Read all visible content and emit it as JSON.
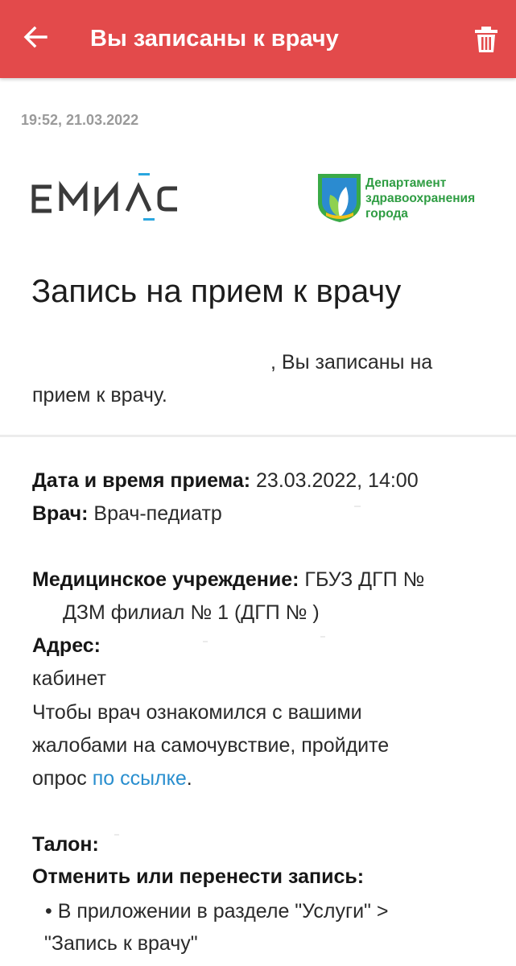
{
  "header": {
    "title": "Вы записаны к врачу",
    "back_icon": "arrow-left-icon",
    "delete_icon": "trash-icon",
    "background": "#e34a4b"
  },
  "timestamp": "19:52, 21.03.2022",
  "logos": {
    "emias": "ЕМИАС",
    "dzm_lines": [
      "Департамент",
      "здравоохранения",
      "города"
    ]
  },
  "heading": "Запись на прием к врачу",
  "greeting": {
    "line1": ", Вы записаны на",
    "line2": "прием к врачу."
  },
  "details": {
    "datetime_label": "Дата и время приема:",
    "datetime_value": " 23.03.2022, 14:00",
    "doctor_label": "Врач:",
    "doctor_value": " Врач-педиатр",
    "clinic_label": "Медицинское учреждение:",
    "clinic_value": " ГБУЗ ДГП №",
    "clinic_value2": "ДЗМ филиал № 1 (ДГП №       )",
    "address_label": "Адрес:",
    "cabinet": "кабинет",
    "survey_line1": "Чтобы врач ознакомился с вашими",
    "survey_line2": "жалобами на самочувствие, пройдите",
    "survey_prefix": "опрос ",
    "survey_link": "по ссылке",
    "survey_suffix": ".",
    "ticket_label": "Талон:",
    "cancel_label": "Отменить или перенести запись:",
    "bullet_line1": "• В приложении в разделе \"Услуги\" >",
    "bullet_line2": "\"Запись к врачу\""
  },
  "colors": {
    "accent": "#e34a4b",
    "link": "#2a8fcf",
    "dzm_green": "#2f9d43"
  }
}
